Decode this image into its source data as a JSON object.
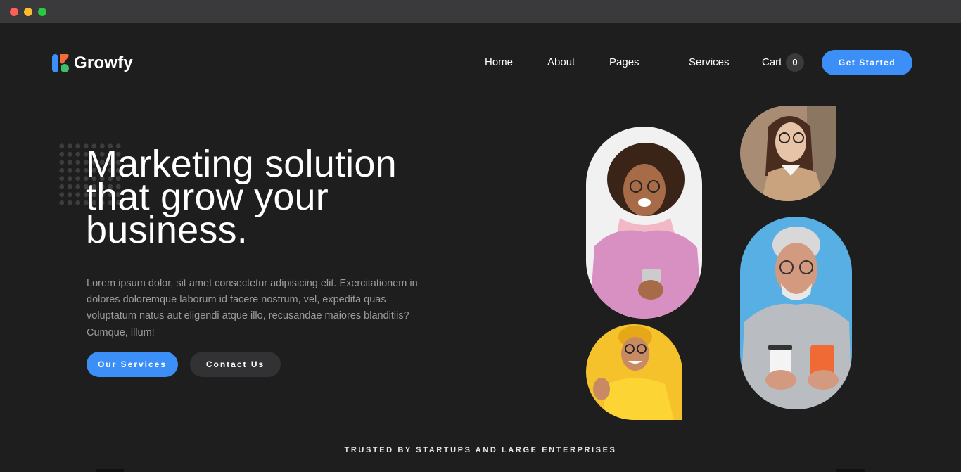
{
  "window": {
    "controls": [
      "close",
      "minimize",
      "maximize"
    ]
  },
  "brand": {
    "name": "Growfy",
    "colors": {
      "blue": "#3b8ff6",
      "orange": "#f26b3a",
      "green": "#3fbf6a"
    }
  },
  "nav": {
    "items": [
      {
        "label": "Home"
      },
      {
        "label": "About"
      },
      {
        "label": "Pages"
      },
      {
        "label": "Services"
      },
      {
        "label": "Cart"
      }
    ],
    "cart_count": "0",
    "cta": "Get Started"
  },
  "hero": {
    "headline": [
      "Marketing solution",
      "that grow your",
      "business."
    ],
    "description": "Lorem ipsum dolor, sit amet consectetur adipisicing elit. Exercitationem in dolores doloremque laborum id facere nostrum, vel, expedita quas voluptatum natus aut eligendi atque illo, recusandae maiores blanditiis? Cumque, illum!",
    "primary_button": "Our Services",
    "secondary_button": "Contact Us"
  },
  "photos": [
    {
      "name": "woman-with-phone-photo",
      "bg": "#f2f2f2"
    },
    {
      "name": "woman-with-glasses-photo",
      "bg": "#a88d74"
    },
    {
      "name": "man-yellow-shirt-photo",
      "bg": "#f5c22c"
    },
    {
      "name": "older-man-with-coffee-photo",
      "bg": "#58afe3"
    }
  ],
  "trusted": {
    "label": "TRUSTED BY STARTUPS AND LARGE ENTERPRISES"
  },
  "colors": {
    "page_bg": "#1e1e1f",
    "accent": "#3b8ff6",
    "muted_text": "#9c9c9f",
    "dark_button": "#323234"
  }
}
